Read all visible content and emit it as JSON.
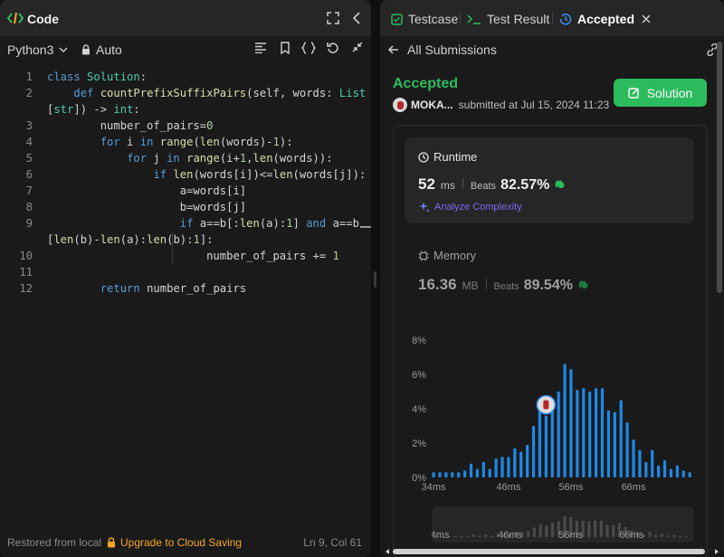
{
  "left": {
    "title": "Code",
    "language": "Python3",
    "mode": "Auto",
    "status_left": "Restored from local",
    "upgrade": "Upgrade to Cloud Saving",
    "cursor": "Ln 9, Col 61"
  },
  "code_lines": [
    {
      "n": "1",
      "t": "class Solution:"
    },
    {
      "n": "2",
      "t": "    def countPrefixSuffixPairs(self, words: List"
    },
    {
      "n": "",
      "t": "[str]) -> int:"
    },
    {
      "n": "3",
      "t": "        number_of_pairs=0"
    },
    {
      "n": "4",
      "t": "        for i in range(len(words)-1):"
    },
    {
      "n": "5",
      "t": "            for j in range(i+1,len(words)):"
    },
    {
      "n": "6",
      "t": "                if len(words[i])<=len(words[j]):"
    },
    {
      "n": "7",
      "t": "                    a=words[i]"
    },
    {
      "n": "8",
      "t": "                    b=words[j]"
    },
    {
      "n": "9",
      "t": "                    if a==b[:len(a):1] and a==b"
    },
    {
      "n": "",
      "t": "[len(b)-len(a):len(b):1]:"
    },
    {
      "n": "10",
      "t": "                        number_of_pairs += 1"
    },
    {
      "n": "11",
      "t": ""
    },
    {
      "n": "12",
      "t": "        return number_of_pairs"
    }
  ],
  "right": {
    "tab_testcase": "Testcase",
    "tab_result": "Test Result",
    "tab_accepted": "Accepted",
    "back_label": "All Submissions",
    "status": "Accepted",
    "user": "MOKA...",
    "submitted": "submitted at Jul 15, 2024 11:23",
    "solution_btn": "Solution",
    "runtime": {
      "label": "Runtime",
      "value": "52",
      "unit": "ms",
      "beats_label": "Beats",
      "beats": "82.57%",
      "analyze": "Analyze Complexity"
    },
    "memory": {
      "label": "Memory",
      "value": "16.36",
      "unit": "MB",
      "beats_label": "Beats",
      "beats": "89.54%"
    }
  },
  "colors": {
    "accent_green": "#2cbb5d",
    "bar_blue": "#1e88e5",
    "code_keyword": "#569cd6",
    "code_class": "#4ec9b0",
    "analyze": "#7c6bf0"
  },
  "chart_data": {
    "type": "bar",
    "y_ticks": [
      "8%",
      "6%",
      "4%",
      "2%",
      "0%"
    ],
    "ylim": [
      0,
      8
    ],
    "x_tick_labels": [
      "34ms",
      "46ms",
      "56ms",
      "66ms"
    ],
    "x_tick_values": [
      34,
      46,
      56,
      66
    ],
    "highlight_ms": 52,
    "series": [
      {
        "x": [
          34,
          35,
          36,
          37,
          38,
          39,
          40,
          41,
          42,
          43,
          44,
          45,
          46,
          47,
          48,
          49,
          50,
          51,
          52,
          53,
          54,
          55,
          56,
          57,
          58,
          59,
          60,
          61,
          62,
          63,
          64,
          65,
          66,
          67,
          68,
          69,
          70,
          71,
          72,
          73,
          74,
          75
        ],
        "values": [
          0.3,
          0.3,
          0.3,
          0.3,
          0.3,
          0.4,
          0.8,
          0.5,
          0.9,
          0.5,
          1.1,
          1.2,
          1.2,
          1.7,
          1.5,
          1.9,
          3.0,
          4.0,
          3.6,
          4.6,
          5.0,
          6.6,
          6.3,
          5.1,
          5.2,
          5.0,
          5.2,
          5.2,
          3.9,
          3.8,
          4.5,
          3.2,
          2.2,
          1.6,
          0.9,
          1.6,
          0.7,
          1.0,
          0.5,
          0.7,
          0.4,
          0.3
        ]
      }
    ]
  }
}
